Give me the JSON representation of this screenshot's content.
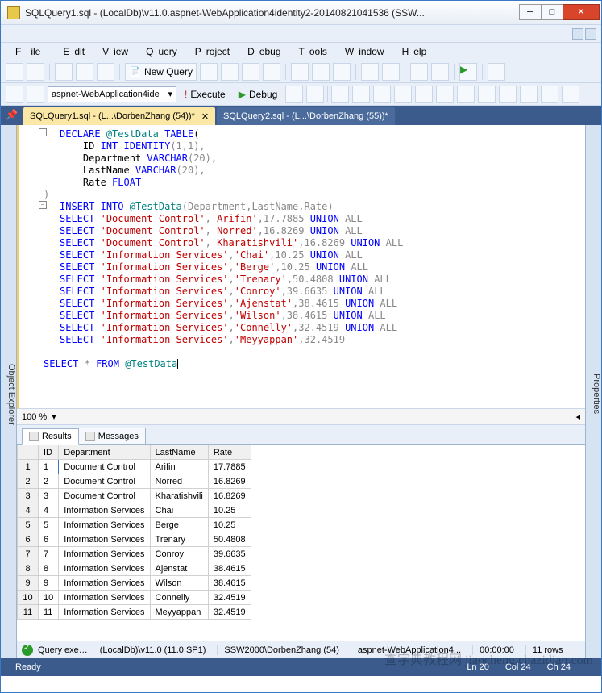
{
  "window": {
    "title": "SQLQuery1.sql - (LocalDb)\\v11.0.aspnet-WebApplication4identity2-20140821041536 (SSW...",
    "min": "─",
    "max": "□",
    "close": "✕"
  },
  "menu": {
    "file": "File",
    "edit": "Edit",
    "view": "View",
    "query": "Query",
    "project": "Project",
    "debug": "Debug",
    "tools": "Tools",
    "window": "Window",
    "help": "Help"
  },
  "toolbar": {
    "new_query": "New Query"
  },
  "toolbar2": {
    "db": "aspnet-WebApplication4ide",
    "execute": "Execute",
    "debug": "Debug"
  },
  "tabs": {
    "t1": "SQLQuery1.sql - (L...\\DorbenZhang (54))*",
    "t2": "SQLQuery2.sql - (L...\\DorbenZhang (55))*"
  },
  "sidetabs": {
    "left": "Object Explorer",
    "right": "Properties"
  },
  "sql": {
    "l1a": "DECLARE",
    "l1b": "@TestData",
    "l1c": "TABLE",
    "l2a": "ID",
    "l2b": "INT",
    "l2c": "IDENTITY",
    "l2d": "(1,1),",
    "l3a": "Department",
    "l3b": "VARCHAR",
    "l3c": "(20),",
    "l4a": "LastName",
    "l4b": "VARCHAR",
    "l4c": "(20),",
    "l5a": "Rate",
    "l5b": "FLOAT",
    "l6": ")",
    "l7a": "INSERT",
    "l7b": "INTO",
    "l7c": "@TestData",
    "l7d": "(Department,LastName,Rate)",
    "rows": [
      {
        "d": "'Document Control'",
        "n": "'Arifin'",
        "r": "17.7885",
        "u": "UNION",
        "a": "ALL"
      },
      {
        "d": "'Document Control'",
        "n": "'Norred'",
        "r": "16.8269",
        "u": "UNION",
        "a": "ALL"
      },
      {
        "d": "'Document Control'",
        "n": "'Kharatishvili'",
        "r": "16.8269",
        "u": "UNION",
        "a": "ALL"
      },
      {
        "d": "'Information Services'",
        "n": "'Chai'",
        "r": "10.25",
        "u": "UNION",
        "a": "ALL"
      },
      {
        "d": "'Information Services'",
        "n": "'Berge'",
        "r": "10.25",
        "u": "UNION",
        "a": "ALL"
      },
      {
        "d": "'Information Services'",
        "n": "'Trenary'",
        "r": "50.4808",
        "u": "UNION",
        "a": "ALL"
      },
      {
        "d": "'Information Services'",
        "n": "'Conroy'",
        "r": "39.6635",
        "u": "UNION",
        "a": "ALL"
      },
      {
        "d": "'Information Services'",
        "n": "'Ajenstat'",
        "r": "38.4615",
        "u": "UNION",
        "a": "ALL"
      },
      {
        "d": "'Information Services'",
        "n": "'Wilson'",
        "r": "38.4615",
        "u": "UNION",
        "a": "ALL"
      },
      {
        "d": "'Information Services'",
        "n": "'Connelly'",
        "r": "32.4519",
        "u": "UNION",
        "a": "ALL"
      },
      {
        "d": "'Information Services'",
        "n": "'Meyyappan'",
        "r": "32.4519",
        "u": "",
        "a": ""
      }
    ],
    "sel": "SELECT",
    "star": "*",
    "from": "FROM",
    "td": "@TestData"
  },
  "zoom": "100 %",
  "restabs": {
    "results": "Results",
    "messages": "Messages"
  },
  "grid": {
    "cols": [
      "",
      "ID",
      "Department",
      "LastName",
      "Rate"
    ],
    "rows": [
      [
        "1",
        "1",
        "Document Control",
        "Arifin",
        "17.7885"
      ],
      [
        "2",
        "2",
        "Document Control",
        "Norred",
        "16.8269"
      ],
      [
        "3",
        "3",
        "Document Control",
        "Kharatishvili",
        "16.8269"
      ],
      [
        "4",
        "4",
        "Information Services",
        "Chai",
        "10.25"
      ],
      [
        "5",
        "5",
        "Information Services",
        "Berge",
        "10.25"
      ],
      [
        "6",
        "6",
        "Information Services",
        "Trenary",
        "50.4808"
      ],
      [
        "7",
        "7",
        "Information Services",
        "Conroy",
        "39.6635"
      ],
      [
        "8",
        "8",
        "Information Services",
        "Ajenstat",
        "38.4615"
      ],
      [
        "9",
        "9",
        "Information Services",
        "Wilson",
        "38.4615"
      ],
      [
        "10",
        "10",
        "Information Services",
        "Connelly",
        "32.4519"
      ],
      [
        "11",
        "11",
        "Information Services",
        "Meyyappan",
        "32.4519"
      ]
    ]
  },
  "qstatus": {
    "ok": "Query exe…",
    "conn": "(LocalDb)\\v11.0 (11.0 SP1)",
    "user": "SSW2000\\DorbenZhang (54)",
    "db": "aspnet-WebApplication4...",
    "time": "00:00:00",
    "rows": "11 rows"
  },
  "status": {
    "ready": "Ready",
    "ln": "Ln 20",
    "col": "Col 24",
    "ch": "Ch 24"
  },
  "watermark": "查字典教程网\njiaocheng.chazidian.com"
}
